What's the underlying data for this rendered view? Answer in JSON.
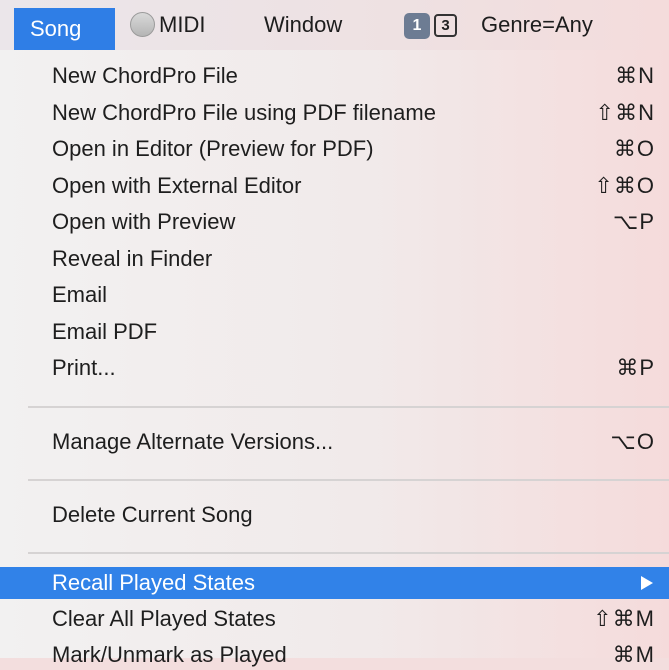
{
  "menubar": {
    "song": "Song",
    "midi": "MIDI",
    "window": "Window",
    "counter_active": "1",
    "counter_total": "3",
    "genre": "Genre=Any"
  },
  "menu": {
    "items": [
      {
        "label": "New ChordPro File",
        "shortcut": "⌘N"
      },
      {
        "label": "New ChordPro File using PDF filename",
        "shortcut": "⇧⌘N"
      },
      {
        "label": "Open in Editor (Preview for PDF)",
        "shortcut": "⌘O"
      },
      {
        "label": "Open with External Editor",
        "shortcut": "⇧⌘O"
      },
      {
        "label": "Open with Preview",
        "shortcut": "⌥P"
      },
      {
        "label": "Reveal in Finder",
        "shortcut": ""
      },
      {
        "label": "Email",
        "shortcut": ""
      },
      {
        "label": "Email PDF",
        "shortcut": ""
      },
      {
        "label": "Print...",
        "shortcut": "⌘P"
      },
      {
        "label": "Manage Alternate Versions...",
        "shortcut": "⌥O"
      },
      {
        "label": "Delete Current Song",
        "shortcut": ""
      },
      {
        "label": "Recall Played States",
        "shortcut": "",
        "submenu": true,
        "highlighted": true
      },
      {
        "label": "Clear All Played States",
        "shortcut": "⇧⌘M"
      },
      {
        "label": "Mark/Unmark as Played",
        "shortcut": "⌘M"
      }
    ]
  },
  "colors": {
    "accent": "#3182e8",
    "menubar_active": "#2f7ee6",
    "badge": "#6d7c93"
  }
}
